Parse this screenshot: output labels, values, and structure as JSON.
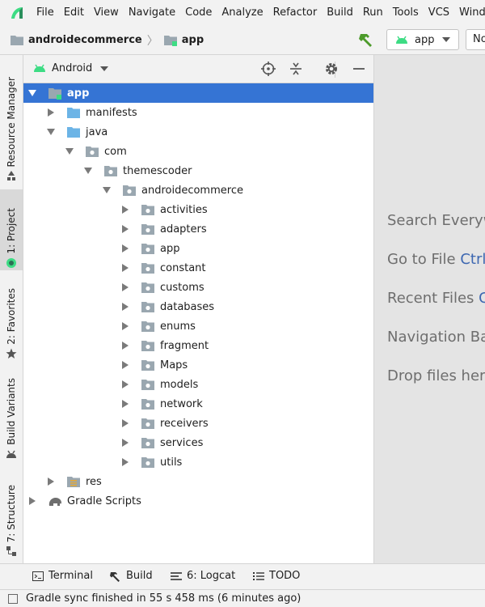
{
  "menu": {
    "items": [
      {
        "label": "File"
      },
      {
        "label": "Edit"
      },
      {
        "label": "View"
      },
      {
        "label": "Navigate"
      },
      {
        "label": "Code"
      },
      {
        "label": "Analyze"
      },
      {
        "label": "Refactor"
      },
      {
        "label": "Build"
      },
      {
        "label": "Run"
      },
      {
        "label": "Tools"
      },
      {
        "label": "VCS"
      },
      {
        "label": "Wind"
      }
    ]
  },
  "navbar": {
    "project": "androidecommerce",
    "module": "app",
    "run_config": "app",
    "device": "No"
  },
  "left_tabs": [
    {
      "label": "Resource Manager",
      "icon": "resource-manager-icon"
    },
    {
      "label": "1: Project",
      "icon": "android-icon"
    },
    {
      "label": "2: Favorites",
      "icon": "star-icon"
    },
    {
      "label": "Build Variants",
      "icon": "android-icon"
    },
    {
      "label": "7: Structure",
      "icon": "structure-icon"
    }
  ],
  "panel": {
    "view_mode": "Android"
  },
  "tree": {
    "rows": [
      {
        "label": "app",
        "depth": 0,
        "arrow": "down",
        "icon": "module-folder",
        "selected": true
      },
      {
        "label": "manifests",
        "depth": 1,
        "arrow": "right",
        "icon": "folder-blue"
      },
      {
        "label": "java",
        "depth": 1,
        "arrow": "down",
        "icon": "folder-blue"
      },
      {
        "label": "com",
        "depth": 2,
        "arrow": "down",
        "icon": "package"
      },
      {
        "label": "themescoder",
        "depth": 3,
        "arrow": "down",
        "icon": "package"
      },
      {
        "label": "androidecommerce",
        "depth": 4,
        "arrow": "down",
        "icon": "package"
      },
      {
        "label": "activities",
        "depth": 5,
        "arrow": "right",
        "icon": "package"
      },
      {
        "label": "adapters",
        "depth": 5,
        "arrow": "right",
        "icon": "package"
      },
      {
        "label": "app",
        "depth": 5,
        "arrow": "right",
        "icon": "package"
      },
      {
        "label": "constant",
        "depth": 5,
        "arrow": "right",
        "icon": "package"
      },
      {
        "label": "customs",
        "depth": 5,
        "arrow": "right",
        "icon": "package"
      },
      {
        "label": "databases",
        "depth": 5,
        "arrow": "right",
        "icon": "package"
      },
      {
        "label": "enums",
        "depth": 5,
        "arrow": "right",
        "icon": "package"
      },
      {
        "label": "fragment",
        "depth": 5,
        "arrow": "right",
        "icon": "package"
      },
      {
        "label": "Maps",
        "depth": 5,
        "arrow": "right",
        "icon": "package"
      },
      {
        "label": "models",
        "depth": 5,
        "arrow": "right",
        "icon": "package"
      },
      {
        "label": "network",
        "depth": 5,
        "arrow": "right",
        "icon": "package"
      },
      {
        "label": "receivers",
        "depth": 5,
        "arrow": "right",
        "icon": "package"
      },
      {
        "label": "services",
        "depth": 5,
        "arrow": "right",
        "icon": "package"
      },
      {
        "label": "utils",
        "depth": 5,
        "arrow": "right",
        "icon": "package"
      },
      {
        "label": "res",
        "depth": 1,
        "arrow": "right",
        "icon": "res-folder"
      },
      {
        "label": "Gradle Scripts",
        "depth": 0,
        "arrow": "right",
        "icon": "gradle-elephant"
      }
    ]
  },
  "editor": {
    "hints": [
      {
        "text": "Search Everywhere",
        "key": ""
      },
      {
        "text": "Go to File ",
        "key": "Ctrl+Shift+N"
      },
      {
        "text": "Recent Files ",
        "key": "Ctrl+E"
      },
      {
        "text": "Navigation Bar",
        "key": ""
      },
      {
        "text": "Drop files here to open",
        "key": ""
      }
    ]
  },
  "bottom_tabs": [
    {
      "label": "Terminal",
      "icon": "terminal-icon"
    },
    {
      "label": "Build",
      "icon": "hammer-icon"
    },
    {
      "label": "6: Logcat",
      "icon": "logcat-icon"
    },
    {
      "label": "TODO",
      "icon": "todo-list-icon"
    }
  ],
  "status": {
    "text": "Gradle sync finished in 55 s 458 ms (6 minutes ago)"
  },
  "colors": {
    "selection": "#3574d4",
    "folder_blue": "#6cb4e6",
    "package_gray": "#9aa7b0",
    "android_green": "#3ddc84",
    "hammer_green": "#4c9a2a",
    "hint_link": "#3d67b1"
  }
}
